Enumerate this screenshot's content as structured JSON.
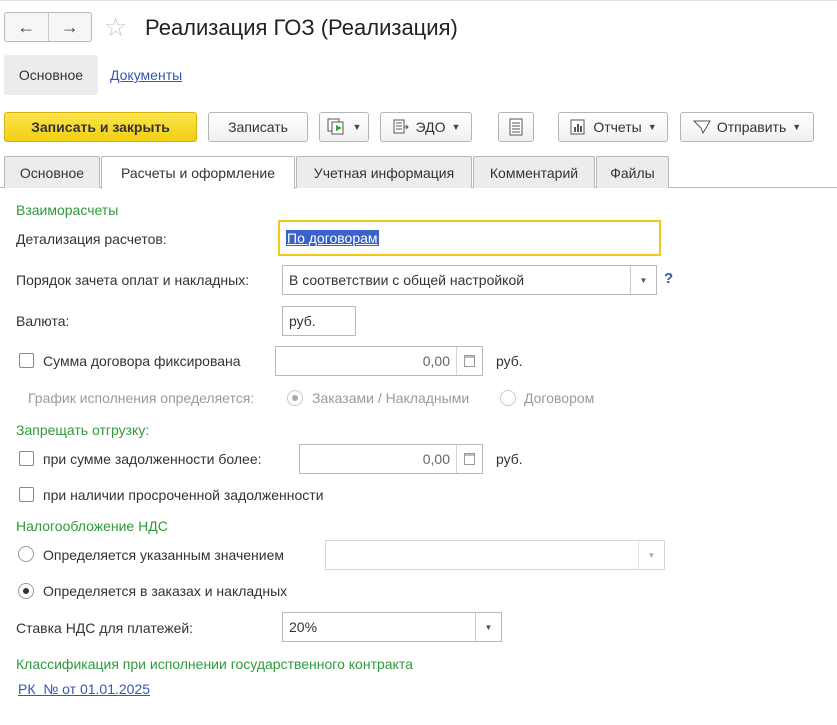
{
  "window": {
    "title": "Реализация ГОЗ (Реализация)",
    "back_icon": "←",
    "forward_icon": "→",
    "star_icon": "☆"
  },
  "sections": {
    "main": "Основное",
    "documents": "Документы"
  },
  "toolbar": {
    "save_close": "Записать и закрыть",
    "save": "Записать",
    "edo": "ЭДО",
    "reports": "Отчеты",
    "send": "Отправить"
  },
  "tabs": [
    {
      "label": "Основное"
    },
    {
      "label": "Расчеты и оформление"
    },
    {
      "label": "Учетная информация"
    },
    {
      "label": "Комментарий"
    },
    {
      "label": "Файлы"
    }
  ],
  "settlements": {
    "heading": "Взаиморасчеты",
    "detail_label": "Детализация расчетов:",
    "detail_value": "По договорам",
    "order_label": "Порядок зачета оплат и накладных:",
    "order_value": "В соответствии с общей настройкой",
    "help": "?",
    "currency_label": "Валюта:",
    "currency_value": "руб.",
    "fixed_sum_label": "Сумма договора фиксирована",
    "fixed_sum_value": "0,00",
    "fixed_sum_unit": "руб.",
    "schedule_label": "График исполнения определяется:",
    "schedule_opt1": "Заказами / Накладными",
    "schedule_opt2": "Договором"
  },
  "shipment": {
    "heading": "Запрещать отгрузку:",
    "debt_label": "при сумме задолженности более:",
    "debt_value": "0,00",
    "debt_unit": "руб.",
    "overdue_label": "при наличии просроченной задолженности"
  },
  "vat": {
    "heading": "Налогообложение НДС",
    "opt1": "Определяется указанным значением",
    "opt2": "Определяется в заказах и накладных",
    "rate_label": "Ставка НДС для платежей:",
    "rate_value": "20%"
  },
  "contract": {
    "heading": "Классификация при исполнении государственного контракта",
    "link": "РК  № от 01.01.2025"
  },
  "colors": {
    "accent_yellow": "#f2cf13",
    "section_green": "#2e9b3b",
    "link_blue": "#3458b0"
  }
}
